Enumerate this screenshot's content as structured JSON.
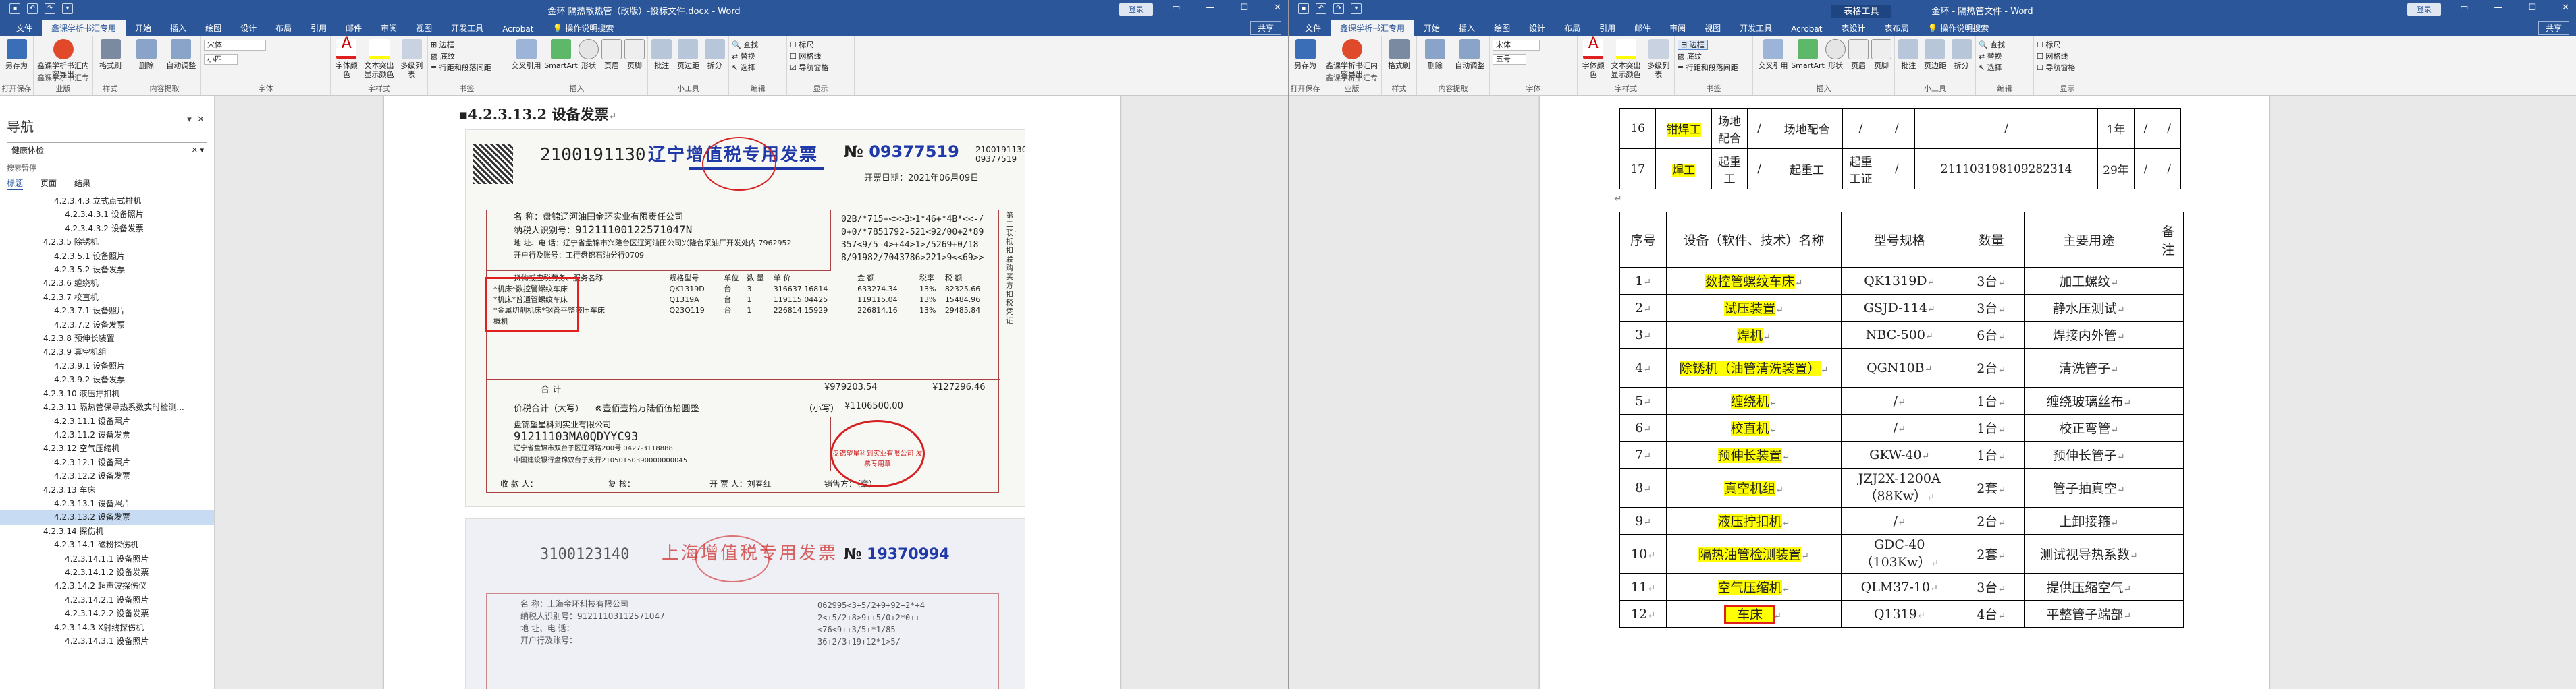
{
  "left_window": {
    "title": "金环 隔热散热管（改版）-投标文件.docx - Word",
    "account": "登录",
    "share": "共享",
    "tabs": [
      "文件",
      "鑫课学析书汇专用",
      "开始",
      "插入",
      "绘图",
      "设计",
      "布局",
      "引用",
      "邮件",
      "审阅",
      "视图",
      "开发工具",
      "Acrobat"
    ],
    "tell_me": "操作说明搜索",
    "ribbon": {
      "groups": [
        {
          "label": "打开保存",
          "items": [
            "另存为"
          ]
        },
        {
          "label": "鑫课学析书汇专业版",
          "items": [
            "鑫课学析书汇内容导出"
          ]
        },
        {
          "label": "样式",
          "items": [
            "格式刷"
          ]
        },
        {
          "label": "内容提取",
          "items": [
            "删除",
            "自动调整"
          ]
        },
        {
          "label": "字体",
          "items": [
            "宋体",
            "小四"
          ]
        },
        {
          "label": "字样式",
          "items": [
            "字体颜色",
            "文本突出显示颜色",
            "多级列表"
          ]
        },
        {
          "label": "书签",
          "items": [
            "边框",
            "底纹",
            "行距和段落间距"
          ]
        },
        {
          "label": "插入",
          "items": [
            "交叉引用",
            "SmartArt",
            "形状",
            "页眉",
            "页脚"
          ]
        },
        {
          "label": "小工具",
          "items": [
            "批注",
            "页边距",
            "拆分"
          ]
        },
        {
          "label": "编辑",
          "items": [
            "查找",
            "替换",
            "选择"
          ]
        },
        {
          "label": "显示",
          "items": [
            "标尺",
            "网格线",
            "导航窗格"
          ]
        }
      ]
    },
    "nav": {
      "title": "导航",
      "search": "健康体检",
      "tools": "搜索暂停",
      "tabs": [
        "标题",
        "页面",
        "结果"
      ],
      "items": [
        "4.2.3.4.3 立式点式排机",
        "4.2.3.4.3.1 设备照片",
        "4.2.3.4.3.2 设备发票",
        "4.2.3.5 除锈机",
        "4.2.3.5.1 设备照片",
        "4.2.3.5.2 设备发票",
        "4.2.3.6 缠绕机",
        "4.2.3.7 校直机",
        "4.2.3.7.1 设备照片",
        "4.2.3.7.2 设备发票",
        "4.2.3.8 预伸长装置",
        "4.2.3.9 真空机组",
        "4.2.3.9.1 设备照片",
        "4.2.3.9.2 设备发票",
        "4.2.3.10 液压拧扣机",
        "4.2.3.11 隔热管保导热系数实时检测...",
        "4.2.3.11.1 设备照片",
        "4.2.3.11.2 设备发票",
        "4.2.3.12 空气压缩机",
        "4.2.3.12.1 设备照片",
        "4.2.3.12.2 设备发票",
        "4.2.3.13 车床",
        "4.2.3.13.1 设备照片",
        "4.2.3.13.2 设备发票",
        "4.2.3.14 探伤机",
        "4.2.3.14.1 磁粉探伤机",
        "4.2.3.14.1.1 设备照片",
        "4.2.3.14.1.2 设备发票",
        "4.2.3.14.2 超声波探伤仪",
        "4.2.3.14.2.1 设备照片",
        "4.2.3.14.2.2 设备发票",
        "4.2.3.14.3 X射线探伤机",
        "4.2.3.14.3.1 设备照片"
      ],
      "selected_index": 23
    },
    "doc": {
      "heading": "4.2.3.13.2 设备发票",
      "invoice1": {
        "code": "2100191130",
        "title": "辽宁增值税专用发票",
        "no_prefix": "№",
        "number": "09377519",
        "code_right": "2100191130",
        "number_right": "09377519",
        "date_label": "开票日期：",
        "date": "2021年06月09日",
        "buyer_name_label": "名      称：",
        "buyer_name": "盘锦辽河油田金环实业有限责任公司",
        "buyer_tax_label": "纳税人识别号：",
        "buyer_tax": "91211100122571047N",
        "buyer_addr_label": "地 址、电 话：",
        "buyer_addr": "辽宁省盘锦市兴隆台区辽河油田公司兴隆台采油厂开发处内 7962952",
        "buyer_bank_label": "开户行及账号：",
        "buyer_bank": "工行盘锦石油分行0709",
        "cipher": [
          "02B/*715+<>>3>1*46+*4B*<<-/",
          "0+0/*7851792-521<92/00+2*89",
          "357<9/5-4>+44>1>/5269+0/18",
          "8/91982/7043786>221>9<<69>>"
        ],
        "items_header": [
          "货物或应税劳务、服务名称",
          "规格型号",
          "单位",
          "数 量",
          "单 价",
          "金 额",
          "税率",
          "税 额"
        ],
        "items": [
          [
            "*机床*数控管螺纹车床",
            "QK1319D",
            "台",
            "3",
            "316637.16814",
            "633274.34",
            "13%",
            "82325.66"
          ],
          [
            "*机床*普通管螺纹车床",
            "Q1319A",
            "台",
            "1",
            "119115.04425",
            "119115.04",
            "13%",
            "15484.96"
          ],
          [
            "*金属切削机床*钢管平整液压车床",
            "Q23Q119",
            "台",
            "1",
            "226814.15929",
            "226814.16",
            "13%",
            "29485.84"
          ],
          [
            "概机",
            "",
            "",
            "",
            "",
            "",
            "",
            ""
          ]
        ],
        "total_label": "合    计",
        "total_amount": "¥979203.54",
        "total_tax": "¥127296.46",
        "grand_label": "价税合计（大写）",
        "grand_words": "⊗壹佰壹拾万陆佰伍拾圆整",
        "grand_small_label": "（小写）",
        "grand_amount": "¥1106500.00",
        "seller_name": "盘锦望星科到实业有限公司",
        "seller_tax": "91211103MA0QDYYC93",
        "seller_addr": "辽宁省盘锦市双台子区辽河路200号 0427-3118888",
        "seller_bank": "中国建设银行盘锦双台子支行21050150390000000045",
        "footer_payee": "收 款 人：",
        "footer_review": "复  核：",
        "footer_issuer": "开 票 人：",
        "footer_issuer_name": "刘春红",
        "footer_seller": "销售方：（章）",
        "side_text": "第二联：抵扣联 购买方扣税凭证",
        "stamp_text": "盘锦望星科到实业有限公司 发票专用章"
      },
      "invoice2": {
        "code": "3100123140",
        "title": "上海增值税专用发票",
        "no_prefix": "№",
        "number": "19370994",
        "lines": [
          "名 称：上海金环科技有限公司",
          "纳税人识别号：91211103112571047",
          "地 址、电 话：",
          "开户行及账号："
        ],
        "cipher": [
          "062995<3+5/2+9+92+2*+4",
          "2<+5/2+8>9++5/0+2*0++",
          "<76<9++3/5+*1/85",
          "36+2/3+19+12*1>5/"
        ]
      }
    }
  },
  "right_window": {
    "title": "金环 - 隔热管文件 - Word",
    "context_tab": "表格工具",
    "account": "登录",
    "share": "共享",
    "tabs": [
      "文件",
      "鑫课学析书汇专用",
      "开始",
      "插入",
      "绘图",
      "设计",
      "布局",
      "引用",
      "邮件",
      "审阅",
      "视图",
      "开发工具",
      "Acrobat",
      "表设计",
      "表布局"
    ],
    "tell_me": "操作说明搜索",
    "ribbon": {
      "groups": [
        {
          "label": "打开保存",
          "items": [
            "另存为"
          ]
        },
        {
          "label": "鑫课学析书汇专业版",
          "items": [
            "鑫课学析书汇内容导出"
          ]
        },
        {
          "label": "样式",
          "items": [
            "格式刷"
          ]
        },
        {
          "label": "内容提取",
          "items": [
            "删除",
            "自动调整"
          ]
        },
        {
          "label": "字体",
          "items": [
            "宋体",
            "五号"
          ]
        },
        {
          "label": "字样式",
          "items": [
            "字体颜色",
            "文本突出显示颜色",
            "多级列表"
          ]
        },
        {
          "label": "书签",
          "items": [
            "边框",
            "底纹",
            "行距和段落间距"
          ]
        },
        {
          "label": "插入",
          "items": [
            "交叉引用",
            "SmartArt",
            "形状",
            "页眉",
            "页脚"
          ]
        },
        {
          "label": "小工具",
          "items": [
            "批注",
            "页边距",
            "拆分"
          ]
        },
        {
          "label": "编辑",
          "items": [
            "查找",
            "替换",
            "选择"
          ]
        },
        {
          "label": "显示",
          "items": [
            "标尺",
            "网格线",
            "导航窗格"
          ]
        }
      ]
    },
    "top_table": [
      [
        "16",
        "钳焊工",
        "场地配合",
        "/",
        "场地配合",
        "/",
        "/",
        "/",
        "1年",
        "/",
        "/"
      ],
      [
        "17",
        "焊工",
        "起重工",
        "/",
        "起重工",
        "起重工证",
        "/",
        "211103198109282314",
        "29年",
        "/",
        "/"
      ]
    ],
    "table_header": [
      "序号",
      "设备（软件、技术）名称",
      "型号规格",
      "数量",
      "主要用途",
      "备注"
    ],
    "rows": [
      {
        "no": "1",
        "name": "数控管螺纹车床",
        "model": "QK1319D",
        "qty": "3台",
        "use": "加工螺纹"
      },
      {
        "no": "2",
        "name": "试压装置",
        "model": "GSJD-114",
        "qty": "3台",
        "use": "静水压测试"
      },
      {
        "no": "3",
        "name": "焊机",
        "model": "NBC-500",
        "qty": "6台",
        "use": "焊接内外管"
      },
      {
        "no": "4",
        "name": "除锈机（油管清洗装置）",
        "model": "QGN10B",
        "qty": "2台",
        "use": "清洗管子"
      },
      {
        "no": "5",
        "name": "缠绕机",
        "model": "/",
        "qty": "1台",
        "use": "缠绕玻璃丝布"
      },
      {
        "no": "6",
        "name": "校直机",
        "model": "/",
        "qty": "1台",
        "use": "校正弯管"
      },
      {
        "no": "7",
        "name": "预伸长装置",
        "model": "GKW-40",
        "qty": "1台",
        "use": "预伸长管子"
      },
      {
        "no": "8",
        "name": "真空机组",
        "model": "JZJ2X-1200A（88Kw）",
        "qty": "2套",
        "use": "管子抽真空"
      },
      {
        "no": "9",
        "name": "液压拧扣机",
        "model": "/",
        "qty": "2台",
        "use": "上卸接箍"
      },
      {
        "no": "10",
        "name": "隔热油管检测装置",
        "model": "GDC-40（103Kw）",
        "qty": "2套",
        "use": "测试视导热系数"
      },
      {
        "no": "11",
        "name": "空气压缩机",
        "model": "QLM37-10",
        "qty": "3台",
        "use": "提供压缩空气"
      },
      {
        "no": "12",
        "name": "车床",
        "model": "Q1319",
        "qty": "4台",
        "use": "平整管子端部"
      }
    ]
  },
  "colors": {
    "title_bar": "#2b579a",
    "highlight": "#ffff00",
    "red_box": "#e0201f",
    "stamp": "#d42020"
  }
}
